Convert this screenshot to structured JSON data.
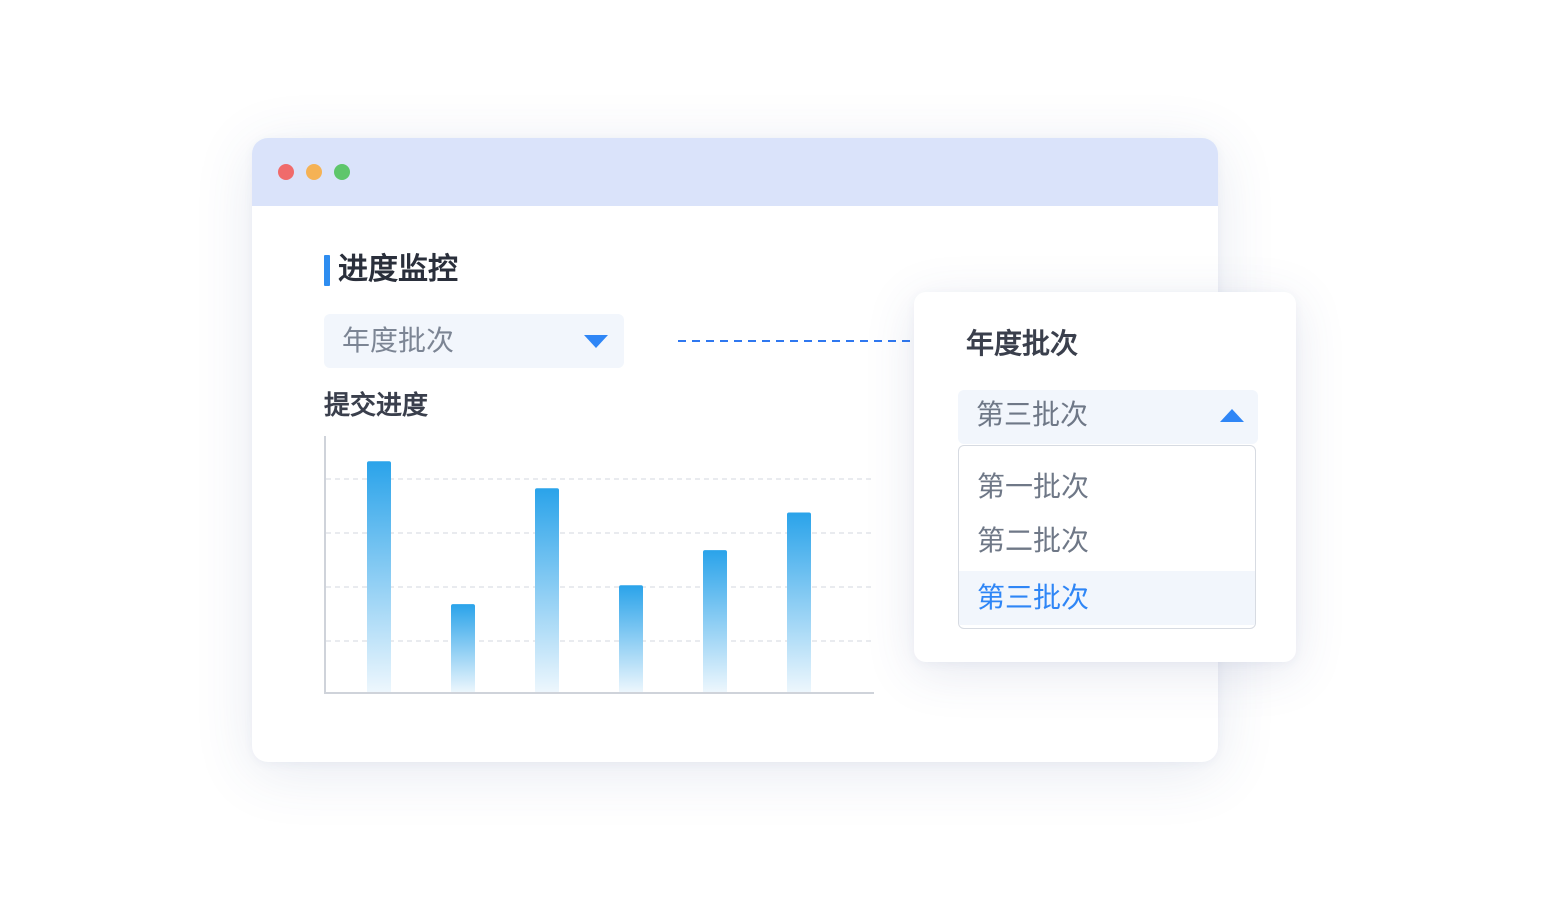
{
  "window": {
    "traffic_lights": {
      "close": "#f06b6b",
      "minimize": "#f5b255",
      "maximize": "#5ec66b"
    }
  },
  "page": {
    "title": "进度监控",
    "filter_select": {
      "placeholder": "年度批次",
      "icon": "caret-down-icon"
    }
  },
  "chart_section": {
    "title": "提交进度"
  },
  "chart_data": {
    "type": "bar",
    "categories": [
      "",
      "",
      "",
      "",
      "",
      ""
    ],
    "values": [
      86,
      33,
      76,
      40,
      53,
      67
    ],
    "ylim": [
      0,
      95
    ],
    "grid": true,
    "bar_gradient": {
      "top": "#2aa3ea",
      "bottom": "#eef7fd"
    }
  },
  "connector": {
    "icon": "dashed-arrow-right-icon",
    "color": "#2f78f0"
  },
  "popup": {
    "title": "年度批次",
    "select": {
      "value": "第三批次",
      "icon": "caret-up-icon"
    },
    "options": [
      "第一批次",
      "第二批次",
      "第三批次"
    ],
    "selected_index": 2,
    "accent": "#2f86f6"
  }
}
